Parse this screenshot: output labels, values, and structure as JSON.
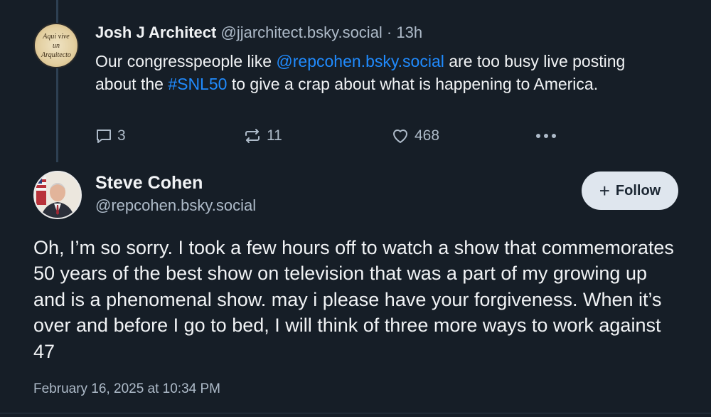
{
  "parent_post": {
    "author_name": "Josh J Architect",
    "author_meta": "@jjarchitect.bsky.social · 13h",
    "avatar_text": [
      "Aqui vive",
      "un",
      "Arquitecto"
    ],
    "text_before": "Our congresspeople like ",
    "mention": "@repcohen.bsky.social",
    "text_middle": " are too busy live posting about the ",
    "hashtag": "#SNL50",
    "text_after": " to give a crap about what is happening to America.",
    "reply_count": "3",
    "repost_count": "11",
    "like_count": "468"
  },
  "main_post": {
    "author_name": "Steve Cohen",
    "author_handle": "@repcohen.bsky.social",
    "follow_label": "Follow",
    "text": "Oh, I’m so sorry. I took a few hours off to watch a show that commemorates 50 years of the best show on television that was a part of my growing up and is a phenomenal show. may i please have your forgiveness. When it’s over and before I go to bed, I will think of three more ways to work against 47",
    "timestamp": "February 16, 2025 at 10:34 PM"
  },
  "colors": {
    "background": "#161e27",
    "link": "#208bfe",
    "muted_text": "#aebbc9",
    "follow_button_bg": "#dfe6ee"
  }
}
